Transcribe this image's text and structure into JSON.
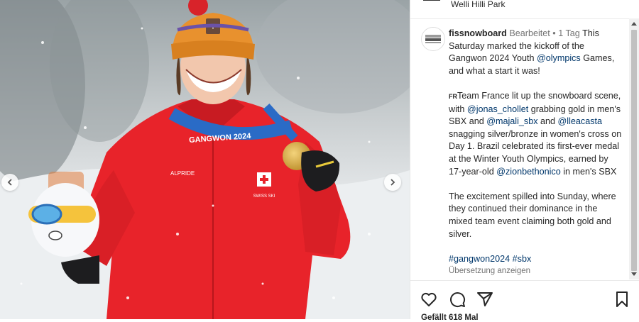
{
  "post": {
    "location": "Welli Hilli Park",
    "username": "fissnowboard",
    "edited": "Bearbeitet",
    "separator": "•",
    "time": "1 Tag",
    "caption": {
      "p1_text": "This Saturday marked the kickoff of the Gangwon 2024 Youth ",
      "p1_mention": "@olympics",
      "p1_tail": " Games, and what a start it was!",
      "p2_flag": "FR",
      "p2_a": "Team France lit up the snowboard scene, with ",
      "p2_m1": "@jonas_chollet",
      "p2_b": " grabbing gold in men's SBX and ",
      "p2_m2": "@majali_sbx",
      "p2_c": " and ",
      "p2_m3": "@lleacasta",
      "p2_d": " snagging silver/bronze in women's cross on Day 1. Brazil celebrated its first-ever medal at the Winter Youth Olympics, earned by 17-year-old ",
      "p2_m4": "@zionbethonico",
      "p2_e": " in men's SBX",
      "p3": "The excitement spilled into Sunday, where they continued their dominance in the mixed team event claiming both gold and silver.",
      "tag1": "#gangwon2024",
      "tag2": "#sbx",
      "translate": "Übersetzung anzeigen"
    },
    "likes": "Gefällt 618 Mal"
  },
  "image": {
    "lanyard_text": "GANGWON 2024",
    "jacket_brand": "ALPRIDE",
    "jacket_team": "SWISS SKI",
    "hat_badge": "+",
    "jacket_color": "#e8232a",
    "hat_color": "#e8912e"
  },
  "icons": {
    "prev": "chevron-left-icon",
    "next": "chevron-right-icon",
    "like": "heart-icon",
    "comment": "comment-icon",
    "share": "paper-plane-icon",
    "save": "bookmark-icon"
  }
}
